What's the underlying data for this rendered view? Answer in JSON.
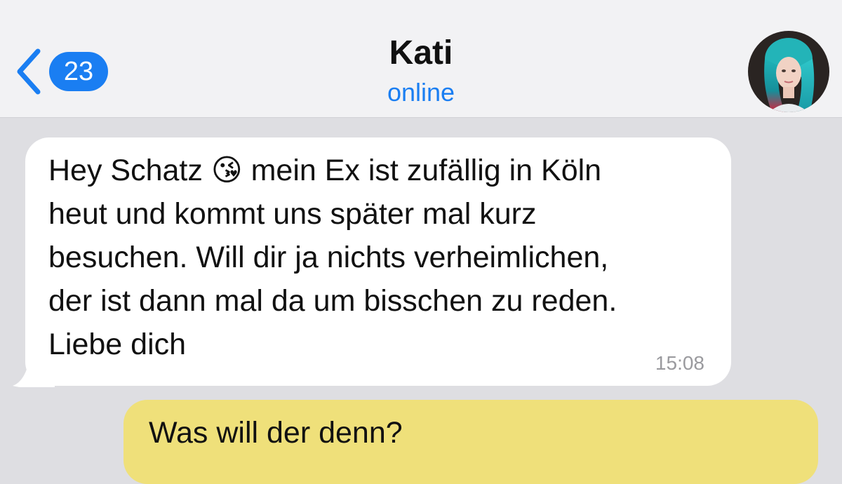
{
  "header": {
    "unread_count": "23",
    "contact_name": "Kati",
    "status": "online"
  },
  "colors": {
    "accent": "#1a7ef2",
    "incoming_bubble": "#ffffff",
    "outgoing_bubble": "#efe07a",
    "chat_background": "#dedee2"
  },
  "messages": [
    {
      "direction": "incoming",
      "text": "Hey Schatz 😘 mein Ex ist zufällig in Köln\nheut und kommt uns später mal kurz\nbesuchen. Will dir ja nichts verheimlichen,\nder ist dann mal da um bisschen zu reden.\nLiebe dich",
      "time": "15:08"
    },
    {
      "direction": "outgoing",
      "text": "Was will der denn?"
    }
  ]
}
